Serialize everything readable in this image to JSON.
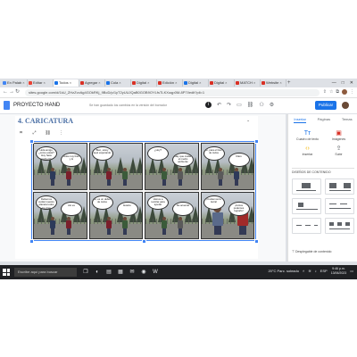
{
  "browser": {
    "tabs": [
      {
        "label": "En Palab",
        "color": "#4285f4"
      },
      {
        "label": "Editar",
        "color": "#ea4335"
      },
      {
        "label": "Todos",
        "color": "#1a73e8"
      },
      {
        "label": "Agregar",
        "color": "#d93025"
      },
      {
        "label": "Cola",
        "color": "#1a73e8"
      },
      {
        "label": "Digital",
        "color": "#d93025"
      },
      {
        "label": "Edición",
        "color": "#d93025"
      },
      {
        "label": "Digital",
        "color": "#1a73e8"
      },
      {
        "label": "Digital",
        "color": "#d93025"
      },
      {
        "label": "MATCH",
        "color": "#d93025"
      },
      {
        "label": "Website",
        "color": "#d93025"
      }
    ],
    "new_tab": "+",
    "window_controls": [
      "—",
      "□",
      "✕"
    ],
    "url": "sites.google.com/d/1kU_ZHzZvvAg4GOkRKj_9BcD/p/1yT2yUUJQaB0GOB9OYLfsTLKXoqp0M-8P7I/edit?pli=1"
  },
  "docs": {
    "title": "PROYECTO HAND",
    "status": "Se han guardado los cambios en la versión del borrador"
  },
  "header": {
    "info_label": "i",
    "publish_label": "Publicar"
  },
  "editor": {
    "section_title": "4. CARICATURA",
    "toolbar_icons": [
      "crop",
      "expand",
      "link",
      "more"
    ]
  },
  "comic": {
    "panels": [
      {
        "bubbles": [
          "Hola amigo, ¿cómo estás? Hoy hace mucho frío",
          "Hola muy bien y tú"
        ]
      },
      {
        "bubbles": [
          "Bien, estoy aquí esperando"
        ]
      },
      {
        "bubbles": [
          "¿Hoy?",
          "Hay que cuidar el medio ambiente"
        ]
      },
      {
        "bubbles": [
          "Sí, para el bien de todos",
          "Claro"
        ]
      },
      {
        "bubbles": [
          "Debemos cuidar nuestro planeta todos los días",
          "Así es"
        ]
      },
      {
        "bubbles": [
          "Sí, es un deber de todos",
          "Exacto"
        ]
      },
      {
        "bubbles": [
          "Vamos a reciclar para ayudar",
          "De acuerdo"
        ]
      },
      {
        "bubbles": [
          "¡Cuidemos la tierra!",
          "¡Juntos podemos lograrlo!"
        ]
      }
    ]
  },
  "sidebar": {
    "tabs": [
      "Insertar",
      "Páginas",
      "Temas"
    ],
    "actions": [
      {
        "label": "Cuadro de texto",
        "icon": "Tт",
        "tone": "blue"
      },
      {
        "label": "Imágenes",
        "icon": "▣",
        "tone": "red"
      },
      {
        "label": "Insertar",
        "icon": "‹›",
        "tone": "yel"
      },
      {
        "label": "Subir",
        "icon": "⇪",
        "tone": "gray"
      }
    ],
    "section_label": "DISEÑOS DE CONTENIDO",
    "footer": "Desplegable de contenido"
  },
  "taskbar": {
    "search_placeholder": "Escribe aquí para buscar",
    "weather": "20°C Parc. soleado",
    "time": "9:46 p.m.",
    "date": "13/06/2023",
    "lang": "ESP"
  }
}
